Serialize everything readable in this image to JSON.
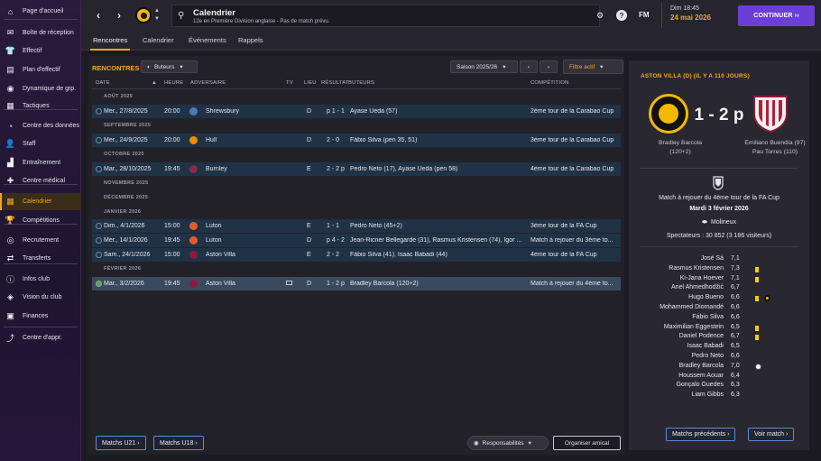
{
  "sidebar": {
    "items": [
      {
        "label": "Page d'accueil",
        "icon": "home-icon",
        "glyph": "⌂"
      },
      {
        "label": "Boîte de réception",
        "icon": "inbox-icon",
        "glyph": "✉"
      },
      {
        "label": "Effectif",
        "icon": "squad-icon",
        "glyph": "👕"
      },
      {
        "label": "Plan d'effectif",
        "icon": "squad-plan-icon",
        "glyph": "▤"
      },
      {
        "label": "Dynamique de grp.",
        "icon": "dynamics-icon",
        "glyph": "◉"
      },
      {
        "label": "Tactiques",
        "icon": "tactics-icon",
        "glyph": "▦"
      },
      {
        "label": "Centre des données",
        "icon": "data-icon",
        "glyph": "◔"
      },
      {
        "label": "Staff",
        "icon": "staff-icon",
        "glyph": "👤"
      },
      {
        "label": "Entraînement",
        "icon": "training-icon",
        "glyph": "▟"
      },
      {
        "label": "Centre médical",
        "icon": "medical-icon",
        "glyph": "✚"
      },
      {
        "label": "Calendrier",
        "icon": "calendar-icon",
        "glyph": "▦"
      },
      {
        "label": "Compétitions",
        "icon": "trophy-icon",
        "glyph": "🏆"
      },
      {
        "label": "Recrutement",
        "icon": "scouting-icon",
        "glyph": "◎"
      },
      {
        "label": "Transferts",
        "icon": "transfers-icon",
        "glyph": "⇄"
      },
      {
        "label": "Infos club",
        "icon": "club-info-icon",
        "glyph": "ⓘ"
      },
      {
        "label": "Vision du club",
        "icon": "club-vision-icon",
        "glyph": "◈"
      },
      {
        "label": "Finances",
        "icon": "finances-icon",
        "glyph": "▣"
      },
      {
        "label": "Centre d'appr.",
        "icon": "learning-icon",
        "glyph": "⤴"
      }
    ]
  },
  "topbar": {
    "title": "Calendrier",
    "subtitle": "12e en Première Division anglaise - Pas de match prévu.",
    "fm": "FM",
    "time": "Dim 18:45",
    "date": "24 mai 2026",
    "continue_label": "CONTINUER ››"
  },
  "tabs": [
    "Rencontres",
    "Calendrier",
    "Événements",
    "Rappels"
  ],
  "fixtures": {
    "title": "RENCONTRES",
    "filter_scorers": "Buteurs",
    "season": "Saison 2025/26",
    "active_filter": "Filtre actif",
    "columns": {
      "date": "DATE",
      "time": "HEURE",
      "opponent": "ADVERSAIRE",
      "tv": "TV",
      "venue": "LIEU",
      "result": "RÉSULTAT",
      "scorers": "BUTEURS",
      "competition": "COMPÉTITION"
    },
    "months": [
      "AOÛT 2025",
      "SEPTEMBRE 2025",
      "OCTOBRE 2025",
      "NOVEMBRE 2025",
      "DÉCEMBRE 2025",
      "JANVIER 2026",
      "FÉVRIER 2026"
    ],
    "rows": [
      {
        "date": "Mer., 27/8/2025",
        "time": "20:00",
        "opponent": "Shrewsbury",
        "badge_color": "#4a7ab8",
        "venue": "D",
        "result": "p 1 - 1",
        "scorers": "Ayase Ueda (57)",
        "competition": "2ème tour de la Carabao Cup"
      },
      {
        "date": "Mer., 24/9/2025",
        "time": "20:00",
        "opponent": "Hull",
        "badge_color": "#f08a00",
        "venue": "D",
        "result": "2 - 0",
        "scorers": "Fábio Silva (pen 35, 51)",
        "competition": "3ème tour de la Carabao Cup"
      },
      {
        "date": "Mar., 28/10/2025",
        "time": "19:45",
        "opponent": "Burnley",
        "badge_color": "#8a2a4a",
        "venue": "E",
        "result": "2 - 2 p",
        "scorers": "Pedro Neto (17), Ayase Ueda (pen 58)",
        "competition": "4ème tour de la Carabao Cup"
      },
      {
        "date": "Dim., 4/1/2026",
        "time": "15:00",
        "opponent": "Luton",
        "badge_color": "#e85a2a",
        "venue": "E",
        "result": "1 - 1",
        "scorers": "Pedro Neto (45+2)",
        "competition": "3ème tour de la FA Cup"
      },
      {
        "date": "Mer., 14/1/2026",
        "time": "19:45",
        "opponent": "Luton",
        "badge_color": "#e85a2a",
        "venue": "D",
        "result": "p 4 - 2",
        "scorers": "Jean-Ricner Bellegarde (31), Rasmus Kristensen (74), Igor ...",
        "competition": "Match à rejouer du 3ème to..."
      },
      {
        "date": "Sam., 24/1/2026",
        "time": "15:00",
        "opponent": "Aston Villa",
        "badge_color": "#8a1a3a",
        "venue": "E",
        "result": "2 - 2",
        "scorers": "Fábio Silva (41), Isaac Babadi (44)",
        "competition": "4ème tour de la FA Cup"
      },
      {
        "date": "Mar., 3/2/2026",
        "time": "19:45",
        "opponent": "Aston Villa",
        "badge_color": "#8a1a3a",
        "venue": "D",
        "result": "1 - 2 p",
        "scorers": "Bradley Barcola (120+2)",
        "competition": "Match à rejouer du 4ème to..."
      }
    ],
    "btn_u21": "Matchs U21 ›",
    "btn_u18": "Matchs U18 ›",
    "responsibilities": "Responsabilités",
    "friendly": "Organiser amical"
  },
  "match_detail": {
    "header": "ASTON VILLA (D) (IL Y A 110 JOURS)",
    "score": "1 - 2 p",
    "home_scorer_1": "Bradley Barcola",
    "home_scorer_2": "(120+2)",
    "away_scorer_1": "Emiliano Buendía (97)",
    "away_scorer_2": "Pau Torres (110)",
    "description": "Match à rejouer du 4ème tour de la FA Cup",
    "date": "Mardi 3 février 2026",
    "stadium": "Molineux",
    "spectators": "Spectateurs : 30 852 (3 186 visiteurs)",
    "players": [
      {
        "name": "José Sá",
        "rating": "7,1",
        "event": ""
      },
      {
        "name": "Rasmus Kristensen",
        "rating": "7,3",
        "event": "yellow"
      },
      {
        "name": "Ki-Jana Hoever",
        "rating": "7,1",
        "event": "yellow"
      },
      {
        "name": "Anel Ahmedhodžić",
        "rating": "6,7",
        "event": ""
      },
      {
        "name": "Hugo Bueno",
        "rating": "6,6",
        "event": "goal-yellow"
      },
      {
        "name": "Mohammed Diomandé",
        "rating": "6,6",
        "event": ""
      },
      {
        "name": "Fábio Silva",
        "rating": "6,6",
        "event": ""
      },
      {
        "name": "Maximilian Eggestein",
        "rating": "6,5",
        "event": "yellow"
      },
      {
        "name": "Daniel Podence",
        "rating": "6,7",
        "event": "yellow"
      },
      {
        "name": "Isaac Babadi",
        "rating": "6,5",
        "event": ""
      },
      {
        "name": "Pedro Neto",
        "rating": "6,6",
        "event": ""
      },
      {
        "name": "Bradley Barcola",
        "rating": "7,0",
        "event": "ball"
      },
      {
        "name": "Houssem Aouar",
        "rating": "6,4",
        "event": ""
      },
      {
        "name": "Gonçalo Guedes",
        "rating": "6,3",
        "event": ""
      },
      {
        "name": "Liam Gibbs",
        "rating": "6,3",
        "event": ""
      }
    ],
    "btn_previous": "Matchs précédents ›",
    "btn_view": "Voir match ›"
  },
  "colors": {
    "accent": "#f5a623",
    "continue": "#6b3fd6",
    "row": "#203246",
    "selected_row": "#3a4a5e"
  }
}
